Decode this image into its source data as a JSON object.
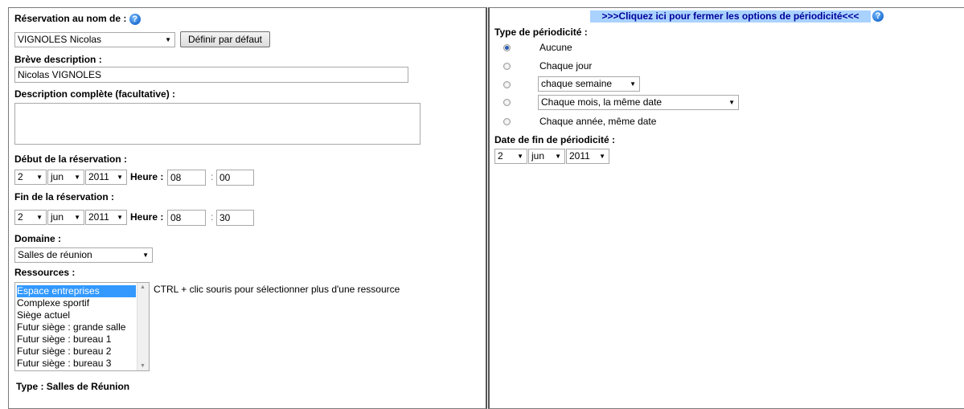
{
  "left": {
    "reservation_label": "Réservation au nom de :",
    "reservation_name": "VIGNOLES Nicolas",
    "default_button": "Définir par défaut",
    "short_desc_label": "Brève description :",
    "short_desc_value": "Nicolas VIGNOLES",
    "full_desc_label": "Description complète (facultative) :",
    "full_desc_value": "",
    "start_label": "Début de la réservation :",
    "start": {
      "day": "2",
      "month": "jun",
      "year": "2011",
      "heure_label": "Heure :",
      "hour": "08",
      "sep": ":",
      "minute": "00"
    },
    "end_label": "Fin de la réservation :",
    "end": {
      "day": "2",
      "month": "jun",
      "year": "2011",
      "heure_label": "Heure :",
      "hour": "08",
      "sep": ":",
      "minute": "30"
    },
    "domain_label": "Domaine :",
    "domain_value": "Salles de réunion",
    "resources_label": "Ressources :",
    "resources": [
      "Espace entreprises",
      "Complexe sportif",
      "Siège actuel",
      "Futur siège : grande salle",
      "Futur siège : bureau 1",
      "Futur siège : bureau 2",
      "Futur siège : bureau 3"
    ],
    "selected_resource_index": 0,
    "resources_hint": "CTRL + clic souris pour sélectionner plus d'une ressource",
    "type_text": "Type : Salles de Réunion"
  },
  "right": {
    "toggle_link": ">>>Cliquez ici pour fermer les options de périodicité<<<",
    "period_type_label": "Type de périodicité :",
    "options": {
      "none": "Aucune",
      "daily": "Chaque jour",
      "weekly_select": "chaque semaine",
      "monthly_select": "Chaque mois, la même date",
      "yearly": "Chaque année, même date"
    },
    "selected_option": "none",
    "end_date_label": "Date de fin de périodicité :",
    "end_date": {
      "day": "2",
      "month": "jun",
      "year": "2011"
    }
  },
  "icons": {
    "help": "help-icon",
    "dropdown": "dropdown-arrow-icon"
  }
}
